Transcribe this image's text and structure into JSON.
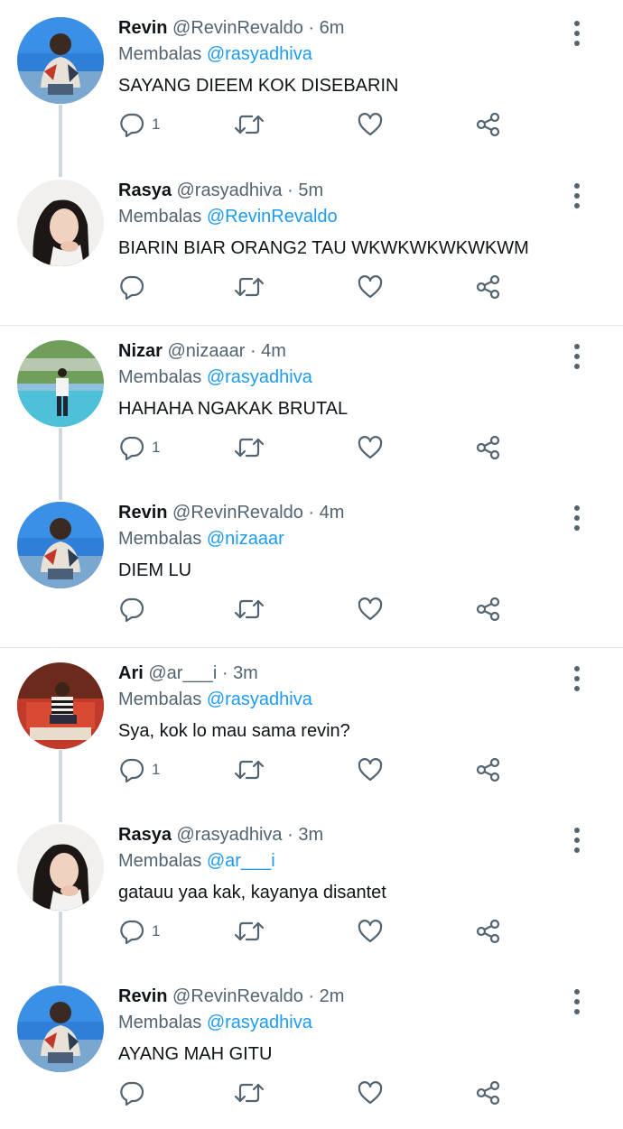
{
  "tweets": [
    {
      "name": "Revin",
      "handle": "@RevinRevaldo",
      "dot": "·",
      "time": "6m",
      "replying_label": "Membalas",
      "mention": "@rasyadhiva",
      "text": "SAYANG DIEEM KOK DISEBARIN",
      "reply_count": "1",
      "avatar": "avatar-revin"
    },
    {
      "name": "Rasya",
      "handle": "@rasyadhiva",
      "dot": "·",
      "time": "5m",
      "replying_label": "Membalas",
      "mention": "@RevinRevaldo",
      "text": "BIARIN BIAR ORANG2 TAU WKWKWKWKWKWM",
      "reply_count": "",
      "avatar": "avatar-rasya"
    },
    {
      "name": "Nizar",
      "handle": "@nizaaar",
      "dot": "·",
      "time": "4m",
      "replying_label": "Membalas",
      "mention": "@rasyadhiva",
      "text": "HAHAHA NGAKAK BRUTAL",
      "reply_count": "1",
      "avatar": "avatar-nizar"
    },
    {
      "name": "Revin",
      "handle": "@RevinRevaldo",
      "dot": "·",
      "time": "4m",
      "replying_label": "Membalas",
      "mention": "@nizaaar",
      "text": "DIEM LU",
      "reply_count": "",
      "avatar": "avatar-revin"
    },
    {
      "name": "Ari",
      "handle": "@ar___i",
      "dot": "·",
      "time": "3m",
      "replying_label": "Membalas",
      "mention": "@rasyadhiva",
      "text": "Sya, kok lo mau sama revin?",
      "reply_count": "1",
      "avatar": "avatar-ari"
    },
    {
      "name": "Rasya",
      "handle": "@rasyadhiva",
      "dot": "·",
      "time": "3m",
      "replying_label": "Membalas",
      "mention": "@ar___i",
      "text": "gatauu yaa kak, kayanya disantet",
      "reply_count": "1",
      "avatar": "avatar-rasya"
    },
    {
      "name": "Revin",
      "handle": "@RevinRevaldo",
      "dot": "·",
      "time": "2m",
      "replying_label": "Membalas",
      "mention": "@rasyadhiva",
      "text": "AYANG MAH GITU",
      "reply_count": "",
      "avatar": "avatar-revin"
    }
  ],
  "icons": {
    "reply": "reply-icon",
    "retweet": "retweet-icon",
    "like": "like-icon",
    "share": "share-icon",
    "more": "more-options-icon"
  },
  "colors": {
    "name": "#0f1419",
    "muted": "#536471",
    "mention": "#1d9bf0",
    "thread_line": "#cfd9de"
  }
}
